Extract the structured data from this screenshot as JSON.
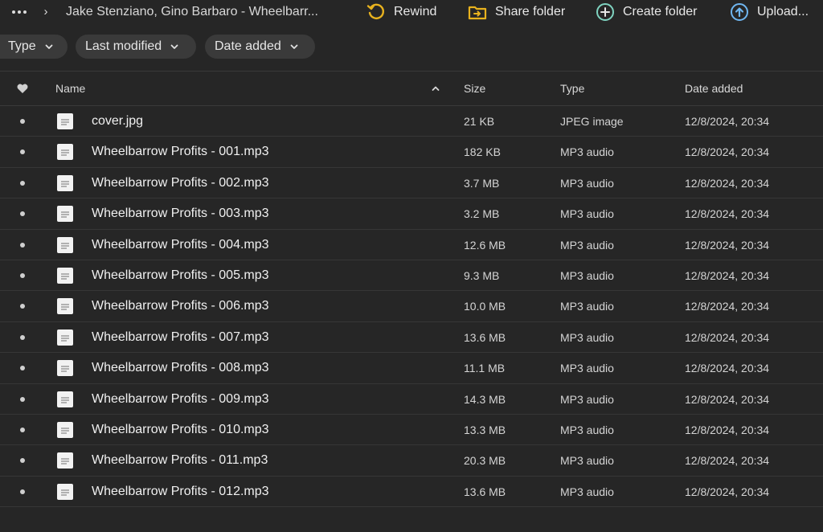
{
  "breadcrumb": {
    "path": "Jake Stenziano, Gino Barbaro - Wheelbarr..."
  },
  "toolbar": {
    "rewind_label": "Rewind",
    "share_label": "Share folder",
    "create_label": "Create folder",
    "upload_label": "Upload..."
  },
  "filters": {
    "type_label": "Type",
    "modified_label": "Last modified",
    "added_label": "Date added"
  },
  "table": {
    "headers": {
      "name": "Name",
      "size": "Size",
      "type": "Type",
      "date": "Date added"
    },
    "rows": [
      {
        "name": "cover.jpg",
        "size": "21 KB",
        "type": "JPEG image",
        "date": "12/8/2024, 20:34"
      },
      {
        "name": "Wheelbarrow Profits - 001.mp3",
        "size": "182 KB",
        "type": "MP3 audio",
        "date": "12/8/2024, 20:34"
      },
      {
        "name": "Wheelbarrow Profits - 002.mp3",
        "size": "3.7 MB",
        "type": "MP3 audio",
        "date": "12/8/2024, 20:34"
      },
      {
        "name": "Wheelbarrow Profits - 003.mp3",
        "size": "3.2 MB",
        "type": "MP3 audio",
        "date": "12/8/2024, 20:34"
      },
      {
        "name": "Wheelbarrow Profits - 004.mp3",
        "size": "12.6 MB",
        "type": "MP3 audio",
        "date": "12/8/2024, 20:34"
      },
      {
        "name": "Wheelbarrow Profits - 005.mp3",
        "size": "9.3 MB",
        "type": "MP3 audio",
        "date": "12/8/2024, 20:34"
      },
      {
        "name": "Wheelbarrow Profits - 006.mp3",
        "size": "10.0 MB",
        "type": "MP3 audio",
        "date": "12/8/2024, 20:34"
      },
      {
        "name": "Wheelbarrow Profits - 007.mp3",
        "size": "13.6 MB",
        "type": "MP3 audio",
        "date": "12/8/2024, 20:34"
      },
      {
        "name": "Wheelbarrow Profits - 008.mp3",
        "size": "11.1 MB",
        "type": "MP3 audio",
        "date": "12/8/2024, 20:34"
      },
      {
        "name": "Wheelbarrow Profits - 009.mp3",
        "size": "14.3 MB",
        "type": "MP3 audio",
        "date": "12/8/2024, 20:34"
      },
      {
        "name": "Wheelbarrow Profits - 010.mp3",
        "size": "13.3 MB",
        "type": "MP3 audio",
        "date": "12/8/2024, 20:34"
      },
      {
        "name": "Wheelbarrow Profits - 011.mp3",
        "size": "20.3 MB",
        "type": "MP3 audio",
        "date": "12/8/2024, 20:34"
      },
      {
        "name": "Wheelbarrow Profits - 012.mp3",
        "size": "13.6 MB",
        "type": "MP3 audio",
        "date": "12/8/2024, 20:34"
      }
    ]
  },
  "icons": {
    "more": "more-horizontal-icon",
    "separator": "chevron-right-icon",
    "rewind": "rewind-icon",
    "share": "share-folder-icon",
    "create": "plus-circle-icon",
    "upload": "upload-circle-icon",
    "chip_chevron": "chevron-down-icon",
    "favorite": "heart-icon",
    "sort": "chevron-up-icon",
    "file": "file-icon"
  },
  "colors": {
    "background": "#262626",
    "chip": "#3a3a3a",
    "rewind_accent": "#e8b21e",
    "share_accent": "#e8b21e",
    "create_accent": "#7fd3c0",
    "upload_accent": "#6fb6f0"
  }
}
